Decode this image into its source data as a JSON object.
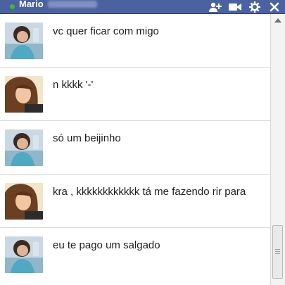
{
  "window": {
    "title": "Mario",
    "status_color": "#42b72a",
    "titlebar_color": "#4a63a0",
    "icons": [
      "add-friend-icon",
      "video-call-icon",
      "gear-icon",
      "close-icon"
    ]
  },
  "messages": [
    {
      "avatar": "avatar-girl-1",
      "text": "vc quer ficar com migo"
    },
    {
      "avatar": "avatar-girl-2",
      "text": "n kkkk '-'"
    },
    {
      "avatar": "avatar-girl-1",
      "text": "só um beijinho"
    },
    {
      "avatar": "avatar-girl-2",
      "text": "kra , kkkkkkkkkkkk tá me fazendo rir para"
    },
    {
      "avatar": "avatar-girl-1",
      "text": "eu te pago um salgado"
    }
  ]
}
